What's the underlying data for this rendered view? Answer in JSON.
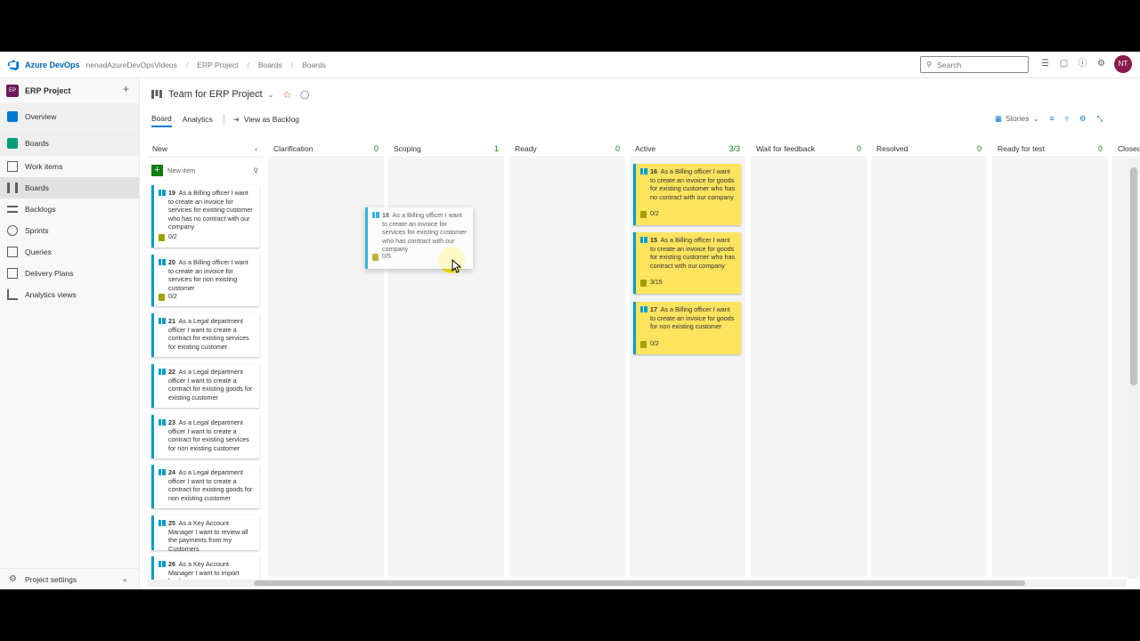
{
  "topbar": {
    "brand": "Azure DevOps",
    "org": "nenadAzureDevOpsVideos",
    "crumbs": [
      "ERP Project",
      "Boards",
      "Boards"
    ],
    "search_placeholder": "Search",
    "avatar_initials": "NT"
  },
  "sidebar": {
    "project_badge": "EP",
    "project_name": "ERP Project",
    "items": [
      {
        "label": "Overview"
      },
      {
        "label": "Boards"
      },
      {
        "label": "Work items"
      },
      {
        "label": "Boards"
      },
      {
        "label": "Backlogs"
      },
      {
        "label": "Sprints"
      },
      {
        "label": "Queries"
      },
      {
        "label": "Delivery Plans"
      },
      {
        "label": "Analytics views"
      }
    ],
    "settings_label": "Project settings"
  },
  "header": {
    "team_title": "Team for ERP Project",
    "tabs": [
      {
        "label": "Board"
      },
      {
        "label": "Analytics"
      }
    ],
    "view_backlog": "View as Backlog",
    "stories_label": "Stories"
  },
  "board": {
    "columns": [
      {
        "name": "New",
        "count": ""
      },
      {
        "name": "Clarification",
        "count": "0"
      },
      {
        "name": "Scoping",
        "count": "1"
      },
      {
        "name": "Ready",
        "count": "0"
      },
      {
        "name": "Active",
        "count": "3/3"
      },
      {
        "name": "Wait for feedback",
        "count": "0"
      },
      {
        "name": "Resolved",
        "count": "0"
      },
      {
        "name": "Ready for test",
        "count": "0"
      },
      {
        "name": "Closed",
        "count": ""
      }
    ],
    "new_item_label": "New item",
    "new_cards": [
      {
        "id": "19",
        "title": "As a Billing officer I want to create an invoice for services for existing customer who has no contract with our company",
        "tasks": "0/2"
      },
      {
        "id": "20",
        "title": "As a Billing officer I want to create an invoice for services for non existing customer",
        "tasks": "0/2"
      },
      {
        "id": "21",
        "title": "As a Legal department officer I want to create a contract for existing services for existing customer",
        "tasks": ""
      },
      {
        "id": "22",
        "title": "As a Legal department officer I want to create a contract for existing goods for existing customer",
        "tasks": ""
      },
      {
        "id": "23",
        "title": "As a Legal department officer I want to create a contract for existing services for non existing customer",
        "tasks": ""
      },
      {
        "id": "24",
        "title": "As a Legal department officer I want to create a contract for existing goods for non existing customer",
        "tasks": ""
      },
      {
        "id": "25",
        "title": "As a Key Account Manager I want to review all the payments from my Customers",
        "tasks": ""
      },
      {
        "id": "26",
        "title": "As a Key Account Manager I want to import bank",
        "tasks": ""
      }
    ],
    "dragged_card": {
      "id": "18",
      "title": "As a Billing officer I want to create an invoice for services for existing customer who has contract with our company",
      "tasks": "0/5"
    },
    "active_cards": [
      {
        "id": "16",
        "title": "As a Billing officer I want to create an invoice for goods for existing customer who has no contract with our company",
        "tasks": "0/2"
      },
      {
        "id": "15",
        "title": "As a Billing officer I want to create an invoice for goods for existing customer who has contract with our company",
        "tasks": "3/15"
      },
      {
        "id": "17",
        "title": "As a Billing officer I want to create an invoice for goods for non existing customer",
        "tasks": "0/2"
      }
    ]
  },
  "colors": {
    "accent": "#0078d4",
    "story_border": "#009ccc",
    "active_card": "#fce45f",
    "count_green": "#107c10"
  }
}
